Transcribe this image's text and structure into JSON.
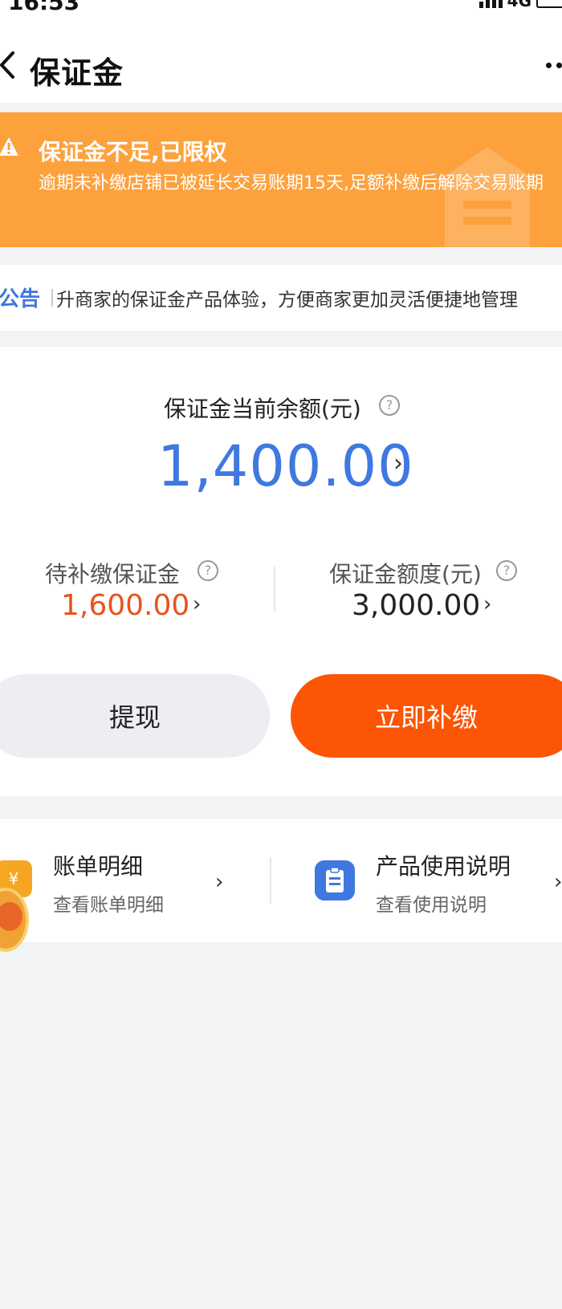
{
  "status_bar": {
    "time": "16:53",
    "network": "4G"
  },
  "nav": {
    "title": "保证金"
  },
  "alert": {
    "title": "保证金不足,已限权",
    "description": "逾期未补缴店铺已被延长交易账期15天,足额补缴后解除交易账期"
  },
  "notice": {
    "label": "公告",
    "text": "升商家的保证金产品体验，方便商家更加灵活便捷地管理"
  },
  "balance": {
    "label": "保证金当前余额(元)",
    "amount": "1,400.00",
    "help_icon": "?",
    "chevron": "›"
  },
  "stats": {
    "pending": {
      "label": "待补缴保证金",
      "value": "1,600.00"
    },
    "quota": {
      "label": "保证金额度(元)",
      "value": "3,000.00"
    }
  },
  "actions": {
    "withdraw_label": "提现",
    "pay_label": "立即补缴"
  },
  "links": {
    "bill": {
      "title": "账单明细",
      "subtitle": "查看账单明细",
      "icon_glyph": "¥"
    },
    "guide": {
      "title": "产品使用说明",
      "subtitle": "查看使用说明"
    }
  },
  "colors": {
    "alert_bg": "#fda13d",
    "balance_amount": "#3f78e0",
    "pending_value": "#e8531c",
    "pay_button": "#fb5505",
    "notice_label": "#3f77de"
  },
  "icons": [
    "back-icon",
    "more-icon",
    "warning-icon",
    "help-icon",
    "chevron-right-icon",
    "bill-icon",
    "document-icon"
  ]
}
